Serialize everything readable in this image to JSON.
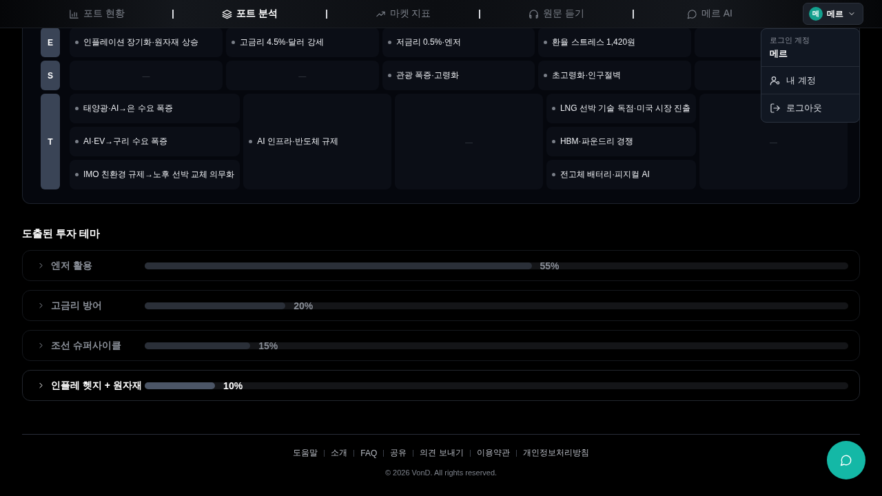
{
  "nav": {
    "items": [
      {
        "label": "포트 현황",
        "selected": false
      },
      {
        "label": "포트 분석",
        "selected": true
      },
      {
        "label": "마켓 지표",
        "selected": false
      },
      {
        "label": "원문 듣기",
        "selected": false
      },
      {
        "label": "메르 AI",
        "selected": false
      }
    ],
    "user": {
      "avatar": "메",
      "name": "메르"
    }
  },
  "menu": {
    "caption": "로그인 계정",
    "account": "메르",
    "items": [
      {
        "label": "내 계정"
      },
      {
        "label": "로그아웃"
      }
    ]
  },
  "matrix": {
    "rows": [
      {
        "key": "E",
        "cells": [
          {
            "kind": "list",
            "items": [
              "인플레이션 장기화·원자재 상승"
            ]
          },
          {
            "kind": "list",
            "items": [
              "고금리 4.5%·달러 강세"
            ]
          },
          {
            "kind": "list",
            "items": [
              "저금리 0.5%·엔저"
            ]
          },
          {
            "kind": "list",
            "items": [
              "환율 스트레스 1,420원"
            ]
          },
          {
            "kind": "covered"
          }
        ]
      },
      {
        "key": "S",
        "cells": [
          {
            "kind": "empty",
            "text": "—"
          },
          {
            "kind": "empty",
            "text": "—"
          },
          {
            "kind": "list",
            "items": [
              "관광 폭증·고령화"
            ]
          },
          {
            "kind": "list",
            "items": [
              "초고령화·인구절벽"
            ]
          },
          {
            "kind": "covered"
          }
        ]
      },
      {
        "key": "T",
        "cells": [
          {
            "kind": "list",
            "items": [
              "태양광·AI→은 수요 폭증",
              "AI·EV→구리 수요 폭증",
              "IMO 친환경 규제→노후 선박 교체 의무화"
            ]
          },
          {
            "kind": "list",
            "items": [
              "AI 인프라·반도체 규제"
            ]
          },
          {
            "kind": "empty",
            "text": "—"
          },
          {
            "kind": "list",
            "items": [
              "LNG 선박 기술 독점·미국 시장 진출",
              "HBM·파운드리 경쟁",
              "전고체 배터리·피지컬 AI"
            ]
          },
          {
            "kind": "empty",
            "text": "—"
          }
        ]
      }
    ]
  },
  "themes": {
    "title": "도출된 투자 테마",
    "items": [
      {
        "label": "엔저 활용",
        "level": 0.55,
        "percent": "55%",
        "selected": false
      },
      {
        "label": "고금리 방어",
        "level": 0.2,
        "percent": "20%",
        "selected": false
      },
      {
        "label": "조선 슈퍼사이클",
        "level": 0.15,
        "percent": "15%",
        "selected": false
      },
      {
        "label": "인플레 헷지 + 원자재",
        "level": 0.1,
        "percent": "10%",
        "selected": true
      }
    ]
  },
  "footer": {
    "links": [
      "도움말",
      "소개",
      "FAQ",
      "공유",
      "의견 보내기",
      "이용약관",
      "개인정보처리방침"
    ],
    "copyright": "© 2026 VonD. All rights reserved."
  }
}
